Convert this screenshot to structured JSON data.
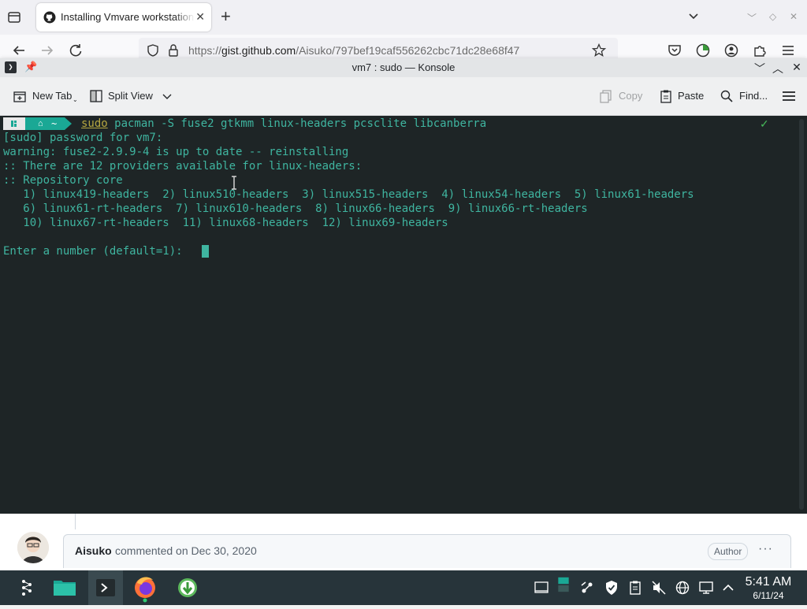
{
  "browser": {
    "tab_title": "Installing Vmvare workstation",
    "url_prefix": "https://",
    "url_host": "gist.github.com",
    "url_path": "/Aisuko/797bef19caf556262cbc71dc28e68f47"
  },
  "konsole": {
    "title": "vm7 : sudo — Konsole",
    "toolbar": {
      "new_tab": "New Tab",
      "split_view": "Split View",
      "copy": "Copy",
      "paste": "Paste",
      "find": "Find..."
    },
    "prompt": {
      "home_symbol": "~",
      "cmd_sudo": "sudo",
      "cmd_rest": " pacman -S fuse2 gtkmm linux-headers pcsclite libcanberra"
    },
    "output": [
      "[sudo] password for vm7:",
      "warning: fuse2-2.9.9-4 is up to date -- reinstalling",
      ":: There are 12 providers available for linux-headers:",
      ":: Repository core",
      "   1) linux419-headers  2) linux510-headers  3) linux515-headers  4) linux54-headers  5) linux61-headers",
      "   6) linux61-rt-headers  7) linux610-headers  8) linux66-headers  9) linux66-rt-headers",
      "   10) linux67-rt-headers  11) linux68-headers  12) linux69-headers",
      "",
      "Enter a number (default=1): "
    ],
    "status_check": "✓"
  },
  "gist": {
    "author": "Aisuko",
    "meta": "commented on Dec 30, 2020",
    "badge": "Author",
    "more": "···"
  },
  "taskbar": {
    "time": "5:41 AM",
    "date": "6/11/24"
  },
  "colors": {
    "terminal_bg": "#1e2526",
    "terminal_fg": "#3fb5a0",
    "prompt_accent": "#1aa895",
    "sudo_color": "#b5a640",
    "taskbar_bg": "#27343a"
  }
}
